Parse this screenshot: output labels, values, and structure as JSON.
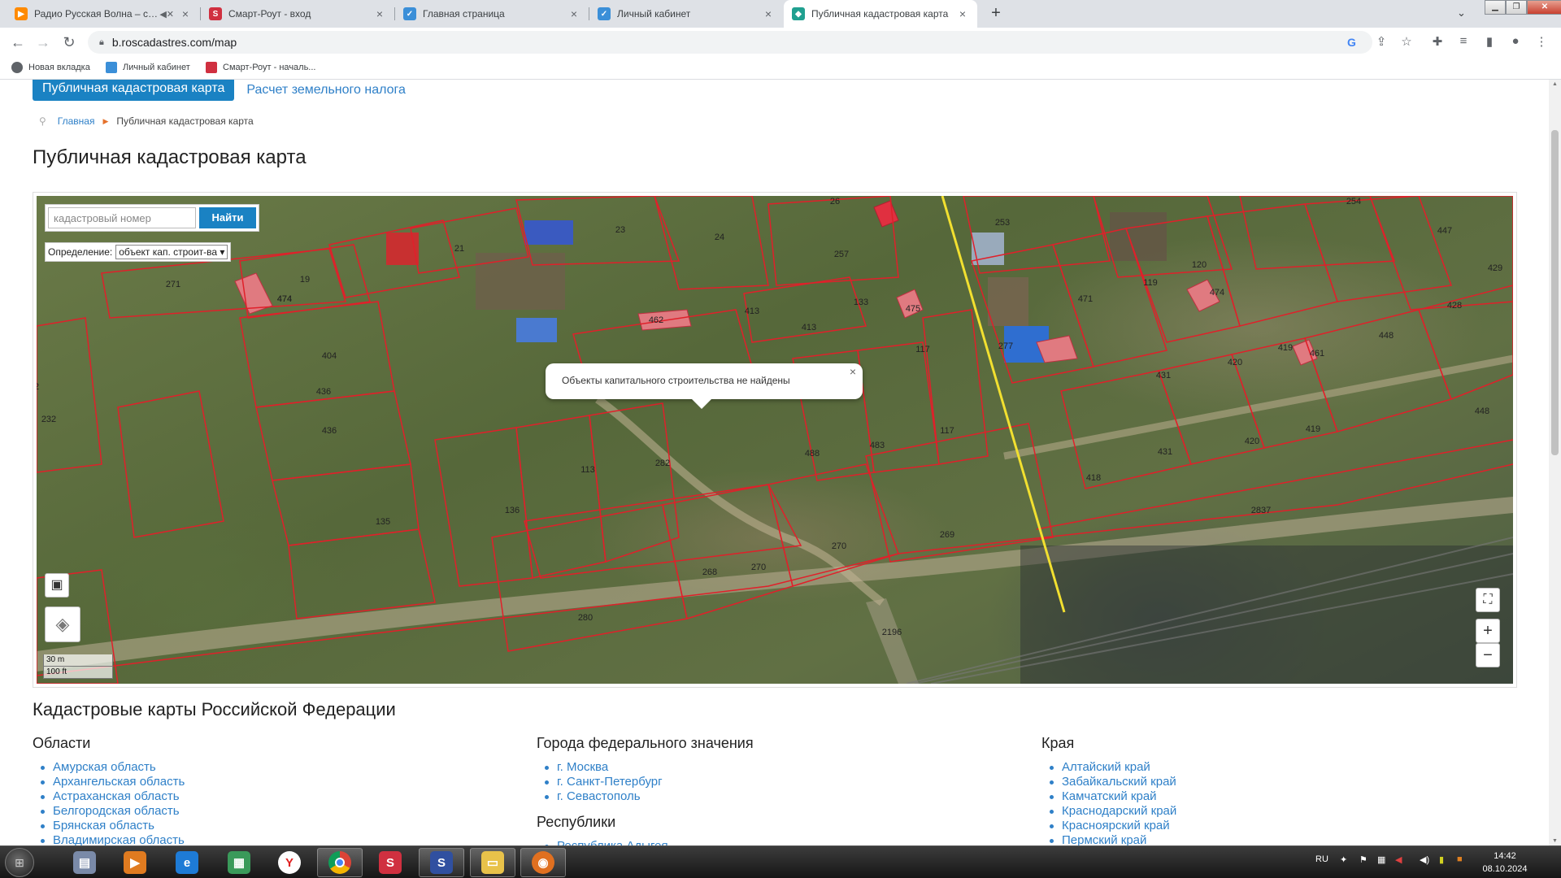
{
  "browser": {
    "tabs": [
      {
        "title": "Радио Русская Волна – слушать",
        "icon": "youtube-play-icon",
        "color": "#ff8a00",
        "muted": true
      },
      {
        "title": "Смарт-Роут - вход",
        "icon": "smartroute-icon",
        "color": "#d03040"
      },
      {
        "title": "Главная страница",
        "icon": "rosreestr-icon",
        "color": "#3b8fd8"
      },
      {
        "title": "Личный кабинет",
        "icon": "rosreestr-icon",
        "color": "#3b8fd8"
      },
      {
        "title": "Публичная кадастровая карта",
        "icon": "map-pin-icon",
        "color": "#20a090",
        "active": true
      }
    ],
    "url": "b.roscadastres.com/map",
    "bookmarks": [
      {
        "label": "Новая вкладка",
        "color": "#5f6368"
      },
      {
        "label": "Личный кабинет",
        "color": "#3b8fd8"
      },
      {
        "label": "Смарт-Роут - началь...",
        "color": "#d03040"
      }
    ]
  },
  "page": {
    "subnav": {
      "active": "Публичная кадастровая карта",
      "link": "Расчет земельного налога"
    },
    "breadcrumb": {
      "home": "Главная",
      "current": "Публичная кадастровая карта"
    },
    "title": "Публичная кадастровая карта",
    "map": {
      "search_placeholder": "кадастровый номер",
      "search_button": "Найти",
      "definition_label": "Определение:",
      "definition_value": "объект кап. строит-ва",
      "popup_text": "Объекты капитального строительства не найдены",
      "scale_m": "30 m",
      "scale_ft": "100 ft",
      "zoom_in": "+",
      "zoom_out": "−",
      "lot_labels": [
        "26",
        "254",
        "23",
        "24",
        "253",
        "447",
        "21",
        "429",
        "257",
        "120",
        "271",
        "19",
        "119",
        "471",
        "474",
        "428",
        "133",
        "475",
        "413",
        "413",
        "462",
        "277",
        "404",
        "117",
        "419",
        "448",
        "461",
        "436",
        "431",
        "420",
        "282",
        "436",
        "448",
        "232",
        "117",
        "419",
        "488",
        "483",
        "420",
        "113",
        "282",
        "431",
        "418",
        "136",
        "2837",
        "135",
        "269",
        "270",
        "270",
        "268",
        "280",
        "2196",
        "3",
        "2",
        "474",
        "474"
      ]
    },
    "regions_heading": "Кадастровые карты Российской Федерации",
    "columns": [
      {
        "title": "Области",
        "items": [
          "Амурская область",
          "Архангельская область",
          "Астраханская область",
          "Белгородская область",
          "Брянская область",
          "Владимирская область"
        ]
      },
      {
        "title": "Города федерального значения",
        "items": [
          "г. Москва",
          "г. Санкт-Петербург",
          "г. Севастополь"
        ]
      },
      {
        "title": "Края",
        "items": [
          "Алтайский край",
          "Забайкальский край",
          "Камчатский край",
          "Краснодарский край",
          "Красноярский край",
          "Пермский край"
        ]
      }
    ],
    "col2_title2": "Республики",
    "col2_item2": "Республика Адыгея"
  },
  "taskbar": {
    "lang": "RU",
    "time": "14:42",
    "date": "08.10.2024"
  }
}
